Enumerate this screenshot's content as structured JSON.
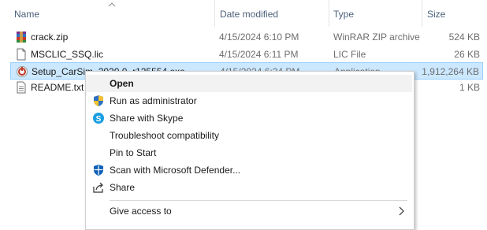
{
  "columns": {
    "name": "Name",
    "date_modified": "Date modified",
    "type": "Type",
    "size": "Size"
  },
  "files": [
    {
      "name": "crack.zip",
      "date": "4/15/2024 6:10 PM",
      "type": "WinRAR ZIP archive",
      "size": "524 KB",
      "icon": "winrar-zip-icon"
    },
    {
      "name": "MSCLIC_SSQ.lic",
      "date": "4/15/2024 6:11 PM",
      "type": "LIC File",
      "size": "26 KB",
      "icon": "document-icon"
    },
    {
      "name": "Setup_CarSim_2020.0_r125554.exe",
      "date": "4/15/2024 6:24 PM",
      "type": "Application",
      "size": "1,912,264 KB",
      "icon": "carsim-setup-icon",
      "selected": true
    },
    {
      "name": "README.txt",
      "date": "",
      "type": "",
      "size": "1 KB",
      "icon": "text-file-icon"
    }
  ],
  "context_menu": {
    "items": [
      {
        "label": "Open",
        "bold": true,
        "icon": ""
      },
      {
        "label": "Run as administrator",
        "icon": "uac-shield-icon"
      },
      {
        "label": "Share with Skype",
        "icon": "skype-icon"
      },
      {
        "label": "Troubleshoot compatibility",
        "icon": ""
      },
      {
        "label": "Pin to Start",
        "icon": ""
      },
      {
        "label": "Scan with Microsoft Defender...",
        "icon": "defender-icon"
      },
      {
        "label": "Share",
        "icon": "share-icon"
      },
      {
        "label": "Give access to",
        "icon": "",
        "submenu": true
      }
    ]
  },
  "colors": {
    "selection_bg": "#cce8ff",
    "selection_border": "#99d1ff",
    "header_text": "#4c607a"
  }
}
